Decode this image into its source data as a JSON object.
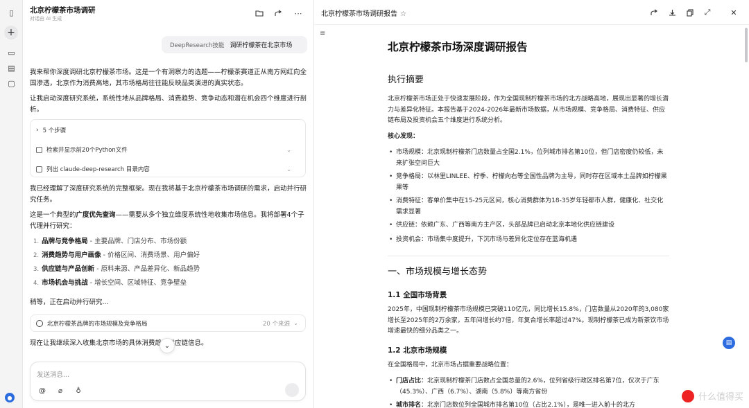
{
  "chat": {
    "title": "北京柠檬茶市场调研",
    "subtitle": "对话由 AI 生成",
    "user_message": {
      "skill": "DeepResearch技能",
      "text": "调研柠檬茶在北京市场"
    },
    "para1": "我来帮你深度调研北京柠檬茶市场。这是一个有洞察力的选题——柠檬茶赛道正从南方网红向全国渗透，北京作为消费高地，其市场格局往往能反映品类演进的真实状态。",
    "para2": "让我启动深度研究系统，系统性地从品牌格局、消费趋势、竞争动态和潜在机会四个维度进行剖析。",
    "steps": {
      "summary": "5 个步骤",
      "items": [
        "检索并显示前20个Python文件",
        "列出 claude-deep-research 目录内容"
      ]
    },
    "para3": "我已经理解了深度研究系统的完整框架。现在我将基于北京柠檬茶市场调研的需求，启动并行研究任务。",
    "para4_pre": "这是一个典型的",
    "para4_bold": "广度优先查询",
    "para4_post": "——需要从多个独立维度系统性地收集市场信息。我将部署4个子代理并行研究：",
    "tasks": [
      {
        "num": "1.",
        "title": "品牌与竞争格局",
        "desc": " - 主要品牌、门店分布、市场份额"
      },
      {
        "num": "2.",
        "title": "消费趋势与用户画像",
        "desc": " - 价格区间、消费场景、用户偏好"
      },
      {
        "num": "3.",
        "title": "供应链与产品创新",
        "desc": " - 原料来源、产品差异化、新品趋势"
      },
      {
        "num": "4.",
        "title": "市场机会与挑战",
        "desc": " - 增长空间、区域特征、竞争壁垒"
      }
    ],
    "para5": "稍等，正在启动并行研究...",
    "source": {
      "label": "北京柠檬茶品牌的市场规模及竞争格局",
      "count": "20 个来源"
    },
    "para6": "现在让我继续深入收集北京市场的具体消费趋和供应链信息。",
    "composer_placeholder": "发送消息..."
  },
  "report": {
    "tab_title": "北京柠檬茶市场调研报告",
    "title": "北京柠檬茶市场深度调研报告",
    "exec_summary_heading": "执行摘要",
    "exec_summary": "北京柠檬茶市场正处于快速发展阶段，作为全国现制柠檬茶市场的北方战略高地，展现出显著的增长潜力与差异化特征。本报告基于2024-2026年最新市场数据，从市场规模、竞争格局、消费特征、供应链布局及投资机会五个维度进行系统分析。",
    "key_findings_label": "核心发现：",
    "key_findings": [
      "市场规模：北京现制柠檬茶门店数量占全国2.1%，位列城市排名第10位，但门店密度仍较低，未来扩张空间巨大",
      "竞争格局：以林里LINLEE、柠季、柠檬向右等全国性品牌为主导，同时存在区域本土品牌如柠檬果果等",
      "消费特征：客单价集中在15-25元区间，核心消费群体为18-35岁年轻都市人群，健康化、社交化需求显著",
      "供应链：依赖广东、广西等南方主产区，头部品牌已启动北京本地化供应链建设",
      "投资机会：市场集中度提升，下沉市场与差异化定位存在蓝海机遇"
    ],
    "section1_heading": "一、市场规模与增长态势",
    "sub1_1_heading": "1.1 全国市场背景",
    "sub1_1_text": "2025年，中国现制柠檬茶市场规模已突破110亿元，同比增长15.8%，门店数量从2020年的3,080家增长至2025年的2万余家，五年间增长约7倍，年复合增长率超过47%。现制柠檬茶已成为新茶饮市场增速最快的细分品类之一。",
    "sub1_2_heading": "1.2 北京市场规模",
    "sub1_2_text": "在全国格局中，北京市场占据重要战略位置：",
    "sub1_2_bullets": [
      {
        "bold": "门店占比",
        "text": "：北京现制柠檬茶门店数占全国总量的2.6%，位列省级行政区排名第7位，仅次于广东（45.3%）、广西（6.7%）、湖南（5.8%）等南方省份"
      },
      {
        "bold": "城市排名",
        "text": "：北京门店数位列全国城市排名第10位（占比2.1%），是唯一进入前十的北方"
      }
    ]
  },
  "watermark": "什么值得买",
  "colors": {
    "accent": "#2d6cdf",
    "panel_bg": "#f4f4f5",
    "border": "#e6e6e8"
  }
}
